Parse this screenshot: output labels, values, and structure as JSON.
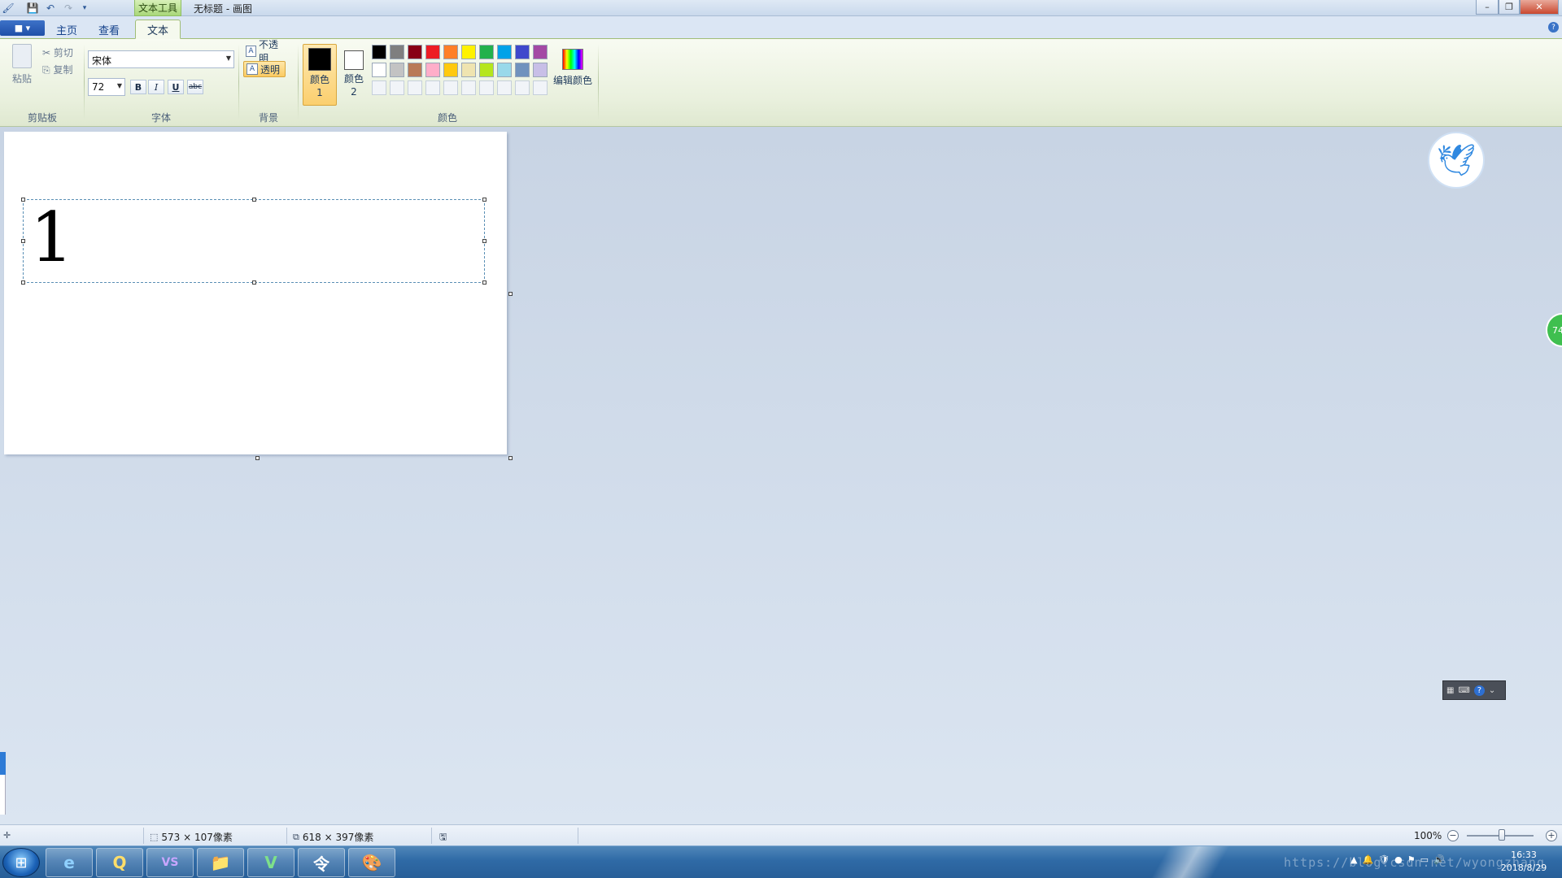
{
  "window": {
    "title": "无标题 - 画图",
    "context_tab": "文本工具",
    "minimize": "–",
    "restore": "❐",
    "close": "✕"
  },
  "quick_access": {
    "app_icon": "paint-app-icon",
    "save": "save-icon",
    "undo": "undo-icon",
    "redo": "redo-icon",
    "customize": "customize-qat-icon"
  },
  "tabs": {
    "file_menu": "■ ▾",
    "items": [
      "主页",
      "查看",
      "文本"
    ],
    "active": "文本"
  },
  "ribbon": {
    "clipboard": {
      "paste": "粘贴",
      "cut": "剪切",
      "copy": "复制",
      "label": "剪贴板"
    },
    "font": {
      "family": "宋体",
      "size": "72",
      "bold": "B",
      "italic": "I",
      "underline": "U",
      "strikethrough": "abc",
      "label": "字体"
    },
    "background": {
      "opaque": "不透明",
      "transparent": "透明",
      "selected": "透明",
      "label": "背景"
    },
    "colors": {
      "color1_label": "颜色 1",
      "color2_label": "颜色 2",
      "color1": "#000000",
      "color2": "#ffffff",
      "edit_colors": "编辑颜色",
      "label": "颜色",
      "palette_row1": [
        "#000000",
        "#7f7f7f",
        "#880015",
        "#ed1c24",
        "#ff7f27",
        "#fff200",
        "#22b14c",
        "#00a2e8",
        "#3f48cc",
        "#a349a4"
      ],
      "palette_row2": [
        "#ffffff",
        "#c3c3c3",
        "#b97a57",
        "#ffaec9",
        "#ffc90e",
        "#efe4b0",
        "#b5e61d",
        "#99d9ea",
        "#7092be",
        "#c8bfe7"
      ]
    }
  },
  "canvas": {
    "text_content": "1",
    "background": "#ffffff"
  },
  "status": {
    "selection_size": "573 × 107像素",
    "image_size": "618 × 397像素",
    "zoom": "100%",
    "zoom_out": "−",
    "zoom_in": "+"
  },
  "overlays": {
    "side_badge": "74",
    "ime": "?"
  },
  "taskbar": {
    "apps": [
      "e",
      "Q",
      "VS",
      "📁",
      "V",
      "令",
      "🎨"
    ],
    "watermark": "https://blog.csdn.net/wyongzhang",
    "time": "16:33",
    "date": "2018/8/29"
  }
}
